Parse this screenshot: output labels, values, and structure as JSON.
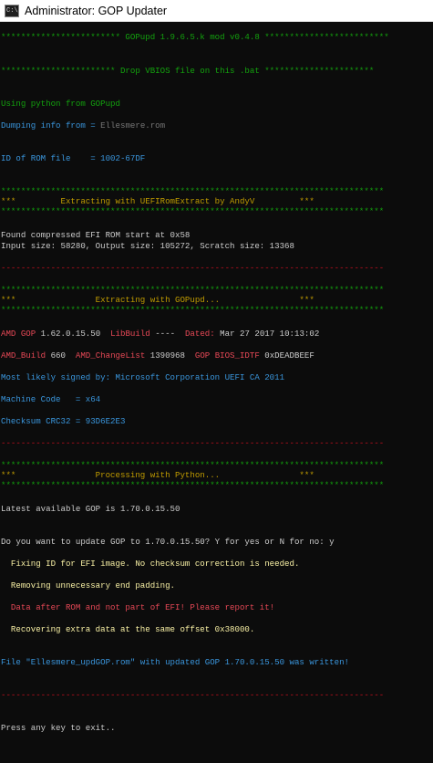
{
  "window": {
    "title": "Administrator:  GOP Updater",
    "icon": "cmd-icon",
    "icon_text": "C:\\_"
  },
  "lines": {
    "l1": "************************ GOPupd 1.9.6.5.k mod v0.4.8 *************************",
    "l2": "*********************** Drop VBIOS file on this .bat **********************",
    "l3": "Using python from GOPupd",
    "l4a": "Dumping info from = ",
    "l4b": "Ellesmere.rom",
    "l5": "ID of ROM file    = 1002-67DF",
    "l6": "*****************************************************************************",
    "l7": "***         Extracting with UEFIRomExtract by AndyV         ***",
    "l8": "*****************************************************************************",
    "l9": "Found compressed EFI ROM start at 0x58",
    "l10": "Input size: 58280, Output size: 105272, Scratch size: 13368",
    "l11": "-----------------------------------------------------------------------------",
    "l12": "*****************************************************************************",
    "l13": "***                Extracting with GOPupd...                ***",
    "l14": "*****************************************************************************",
    "l15": {
      "k1": "AMD GOP ",
      "v1": "1.62.0.15.50  ",
      "k2": "LibBuild ",
      "v2": "----  ",
      "k3": "Dated: ",
      "v3": "Mar 27 2017 10:13:02"
    },
    "l16": {
      "k1": "AMD_Build ",
      "v1": "660  ",
      "k2": "AMD_ChangeList ",
      "v2": "1390968  ",
      "k3": "GOP BIOS_IDTF ",
      "v3": "0xDEADBEEF"
    },
    "l17": "Most likely signed by: Microsoft Corporation UEFI CA 2011",
    "l18": "Machine Code   = x64",
    "l19": "Checksum CRC32 = 93D6E2E3",
    "l20": "-----------------------------------------------------------------------------",
    "l21": "*****************************************************************************",
    "l22": "***                Processing with Python...                ***",
    "l23": "*****************************************************************************",
    "l24": "Latest available GOP is 1.70.0.15.50",
    "l25": "Do you want to update GOP to 1.70.0.15.50? Y for yes or N for no: y",
    "l26": "  Fixing ID for EFI image. No checksum correction is needed.",
    "l27": "  Removing unnecessary end padding.",
    "l28": "  Data after ROM and not part of EFI! Please report it!",
    "l29": "  Recovering extra data at the same offset 0x38000.",
    "l30": "File \"Ellesmere_updGOP.rom\" with updated GOP 1.70.0.15.50 was written!",
    "l31": "-----------------------------------------------------------------------------",
    "l32": "Press any key to exit.."
  },
  "colors": {
    "background": "#0c0c0c",
    "green": "#13a10e",
    "yellow": "#c19c00",
    "white": "#cccccc",
    "cyan": "#3a96dd",
    "red": "#c50f1f",
    "light_yellow": "#f9f1a5",
    "gray": "#767676",
    "light_red": "#e74856"
  }
}
